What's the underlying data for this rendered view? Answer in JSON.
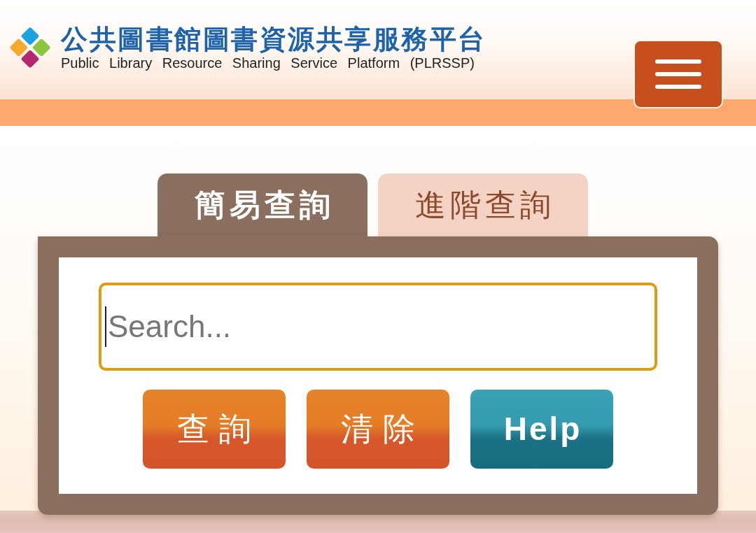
{
  "header": {
    "logo_title": "公共圖書館圖書資源共享服務平台",
    "logo_subtitle": "Public Library Resource Sharing Service Platform (PLRSSP)"
  },
  "tabs": [
    {
      "label": "簡易查詢",
      "selected": true
    },
    {
      "label": "進階查詢",
      "selected": false
    }
  ],
  "search": {
    "placeholder": "Search...",
    "focused": true
  },
  "buttons": [
    {
      "label": "查詢",
      "kind": "primary"
    },
    {
      "label": "清除",
      "kind": "primary"
    },
    {
      "label": "Help",
      "kind": "help"
    }
  ]
}
